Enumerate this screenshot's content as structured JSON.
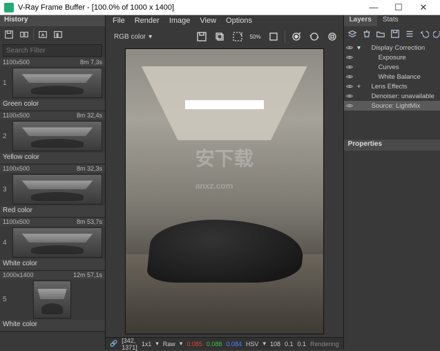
{
  "window": {
    "title": "V-Ray Frame Buffer - [100.0% of 1000 x 1400]",
    "btn_min": "—",
    "btn_max": "☐",
    "btn_close": "✕"
  },
  "history": {
    "header": "History",
    "search_placeholder": "Search Filter",
    "items": [
      {
        "res": "1100x500",
        "time": "8m 7,3s",
        "num": "1",
        "label": "Green color"
      },
      {
        "res": "1100x500",
        "time": "8m 32,4s",
        "num": "2",
        "label": "Yellow color"
      },
      {
        "res": "1100x500",
        "time": "8m 32,3s",
        "num": "3",
        "label": "Red color"
      },
      {
        "res": "1100x500",
        "time": "8m 53,7s",
        "num": "4",
        "label": "White color"
      },
      {
        "res": "1000x1400",
        "time": "12m 57,1s",
        "num": "5",
        "label": "White color"
      }
    ]
  },
  "menu": {
    "file": "File",
    "render": "Render",
    "image": "Image",
    "view": "View",
    "options": "Options"
  },
  "toolbar": {
    "channel": "RGB color",
    "scale": "50%"
  },
  "status": {
    "coord": "[342, 1371]",
    "zoom": "1x1",
    "mode": "Raw",
    "r": "0.085",
    "g": "0.088",
    "b": "0.084",
    "hsv_label": "HSV",
    "hsv_h": "108",
    "hsv_s": "0.1",
    "hsv_v": "0.1",
    "render_label": "Rendering"
  },
  "layers": {
    "tabs": {
      "layers": "Layers",
      "stats": "Stats"
    },
    "items": [
      {
        "label": "Display Correction",
        "expand": "▾",
        "sel": false
      },
      {
        "label": "Exposure",
        "expand": "",
        "sel": false
      },
      {
        "label": "Curves",
        "expand": "",
        "sel": false
      },
      {
        "label": "White Balance",
        "expand": "",
        "sel": false
      },
      {
        "label": "Lens Effects",
        "expand": "+",
        "sel": false
      },
      {
        "label": "Denoiser: unavailable",
        "expand": "",
        "sel": false
      },
      {
        "label": "Source: LightMix",
        "expand": "",
        "sel": true
      }
    ],
    "properties_header": "Properties"
  }
}
